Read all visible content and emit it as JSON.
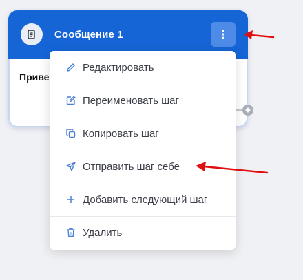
{
  "card": {
    "title": "Сообщение 1",
    "body_text": "Приве"
  },
  "menu": {
    "items": [
      {
        "label": "Редактировать",
        "icon": "pencil-icon"
      },
      {
        "label": "Переименовать шаг",
        "icon": "edit-square-icon"
      },
      {
        "label": "Копировать шаг",
        "icon": "copy-icon"
      },
      {
        "label": "Отправить шаг себе",
        "icon": "send-icon"
      },
      {
        "label": "Добавить следующий шаг",
        "icon": "plus-icon"
      },
      {
        "label": "Удалить",
        "icon": "trash-icon"
      }
    ]
  },
  "colors": {
    "header": "#1565d6",
    "kebab_bg": "#4e8be6",
    "icon": "#4a7fd6",
    "annotation_arrow": "#e01010"
  }
}
